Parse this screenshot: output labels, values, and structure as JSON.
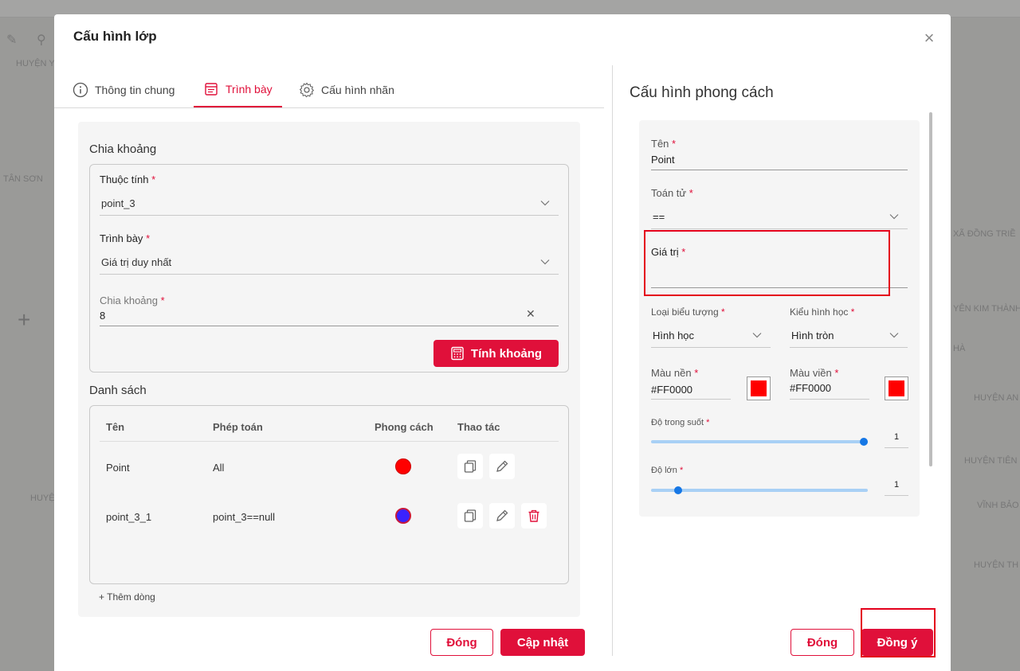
{
  "background": {
    "labels": [
      "HUYỆN Y",
      "TÂN SƠN",
      "HUYỆ",
      "XÃ ĐỒNG TRIỀ",
      "YÊN KIM THÀNH",
      "HÀ",
      "HUYỆN AN",
      "HUYỆN TIÊN",
      "VĨNH BẢO",
      "HUYỆN TH"
    ]
  },
  "modal": {
    "title": "Cấu hình lớp",
    "close_symbol": "×"
  },
  "tabs": [
    {
      "label": "Thông tin chung",
      "icon": "info-icon"
    },
    {
      "label": "Trình bày",
      "icon": "layout-icon",
      "active": true
    },
    {
      "label": "Cấu hình nhãn",
      "icon": "gear-icon"
    }
  ],
  "classify": {
    "section_title": "Chia khoảng",
    "attribute_label": "Thuộc tính",
    "attribute_value": "point_3",
    "display_label": "Trình bày",
    "display_value": "Giá trị duy nhất",
    "interval_label": "Chia khoảng",
    "interval_value": "8",
    "clear_symbol": "✕",
    "calc_button": "Tính khoảng",
    "required_mark": "*"
  },
  "list": {
    "section_title": "Danh sách",
    "headers": [
      "Tên",
      "Phép toán",
      "Phong cách",
      "Thao tác"
    ],
    "rows": [
      {
        "name": "Point",
        "operation": "All",
        "style_color": "#ff0000",
        "style_border": "#cc0000"
      },
      {
        "name": "point_3_1",
        "operation": "point_3==null",
        "style_color": "#3a22ff",
        "style_border": "#c81a3a"
      }
    ],
    "add_row": "+ Thêm dòng"
  },
  "left_footer": {
    "close": "Đóng",
    "update": "Cập nhật"
  },
  "style_config": {
    "title": "Cấu hình phong cách",
    "name_label": "Tên",
    "name_value": "Point",
    "operator_label": "Toán tử",
    "operator_value": "==",
    "value_label": "Giá trị",
    "value_value": "",
    "symbol_type_label": "Loại biểu tượng",
    "symbol_type_value": "Hình học",
    "geometry_label": "Kiểu hình học",
    "geometry_value": "Hình tròn",
    "fill_label": "Màu nền",
    "fill_value": "#FF0000",
    "stroke_label": "Màu viền",
    "stroke_value": "#FF0000",
    "opacity_label": "Độ trong suốt",
    "opacity_value": "1",
    "opacity_level": 1,
    "size_label": "Độ lớn",
    "size_value": "1",
    "size_level": 0.11,
    "required_mark": "*"
  },
  "right_footer": {
    "close": "Đóng",
    "confirm": "Đồng ý"
  },
  "colors": {
    "accent": "#e0103a",
    "swatch": "#ff0000",
    "slider_track": "#a8d0f5",
    "slider_thumb": "#1677e5"
  }
}
